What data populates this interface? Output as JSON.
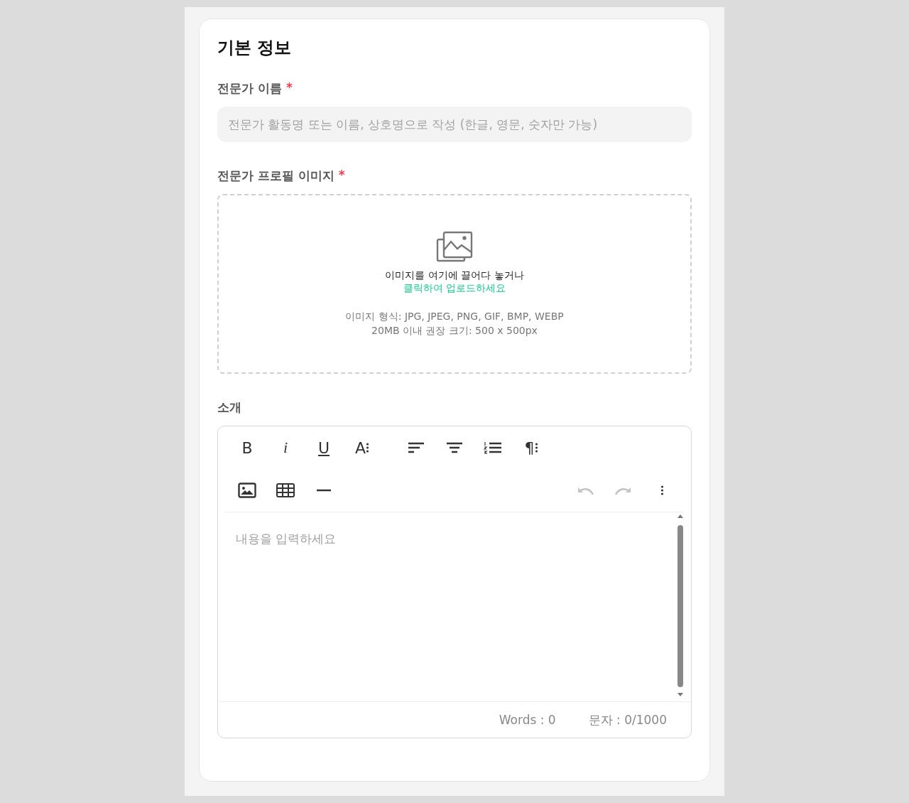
{
  "section_title": "기본 정보",
  "name_field": {
    "label": "전문가 이름",
    "required_mark": "*",
    "placeholder": "전문가 활동명 또는 이름, 상호명으로 작성 (한글, 영문, 숫자만 가능)"
  },
  "image_field": {
    "label": "전문가 프로필 이미지",
    "required_mark": "*",
    "drop_text": "이미지를 여기에 끌어다 놓거나",
    "click_text": "클릭하여 업로드하세요",
    "formats": "이미지 형식: JPG, JPEG, PNG, GIF, BMP, WEBP",
    "size_hint": "20MB 이내 권장 크기: 500 x 500px"
  },
  "intro_field": {
    "label": "소개",
    "toolbar_rows": [
      [
        {
          "kind": "bold",
          "label": "B"
        },
        {
          "kind": "italic",
          "label": "i"
        },
        {
          "kind": "underline",
          "label": "U"
        },
        {
          "kind": "font",
          "label": "A"
        },
        {
          "kind": "align-left"
        },
        {
          "kind": "align-center"
        },
        {
          "kind": "list"
        },
        {
          "kind": "paragraph",
          "label": "¶"
        }
      ],
      [
        {
          "kind": "image"
        },
        {
          "kind": "table"
        },
        {
          "kind": "rule"
        },
        {
          "kind": "undo",
          "disabled": true
        },
        {
          "kind": "redo",
          "disabled": true
        },
        {
          "kind": "more"
        }
      ]
    ],
    "placeholder": "내용을 입력하세요",
    "words": "Words : 0",
    "chars": "문자 : 0/1000"
  }
}
